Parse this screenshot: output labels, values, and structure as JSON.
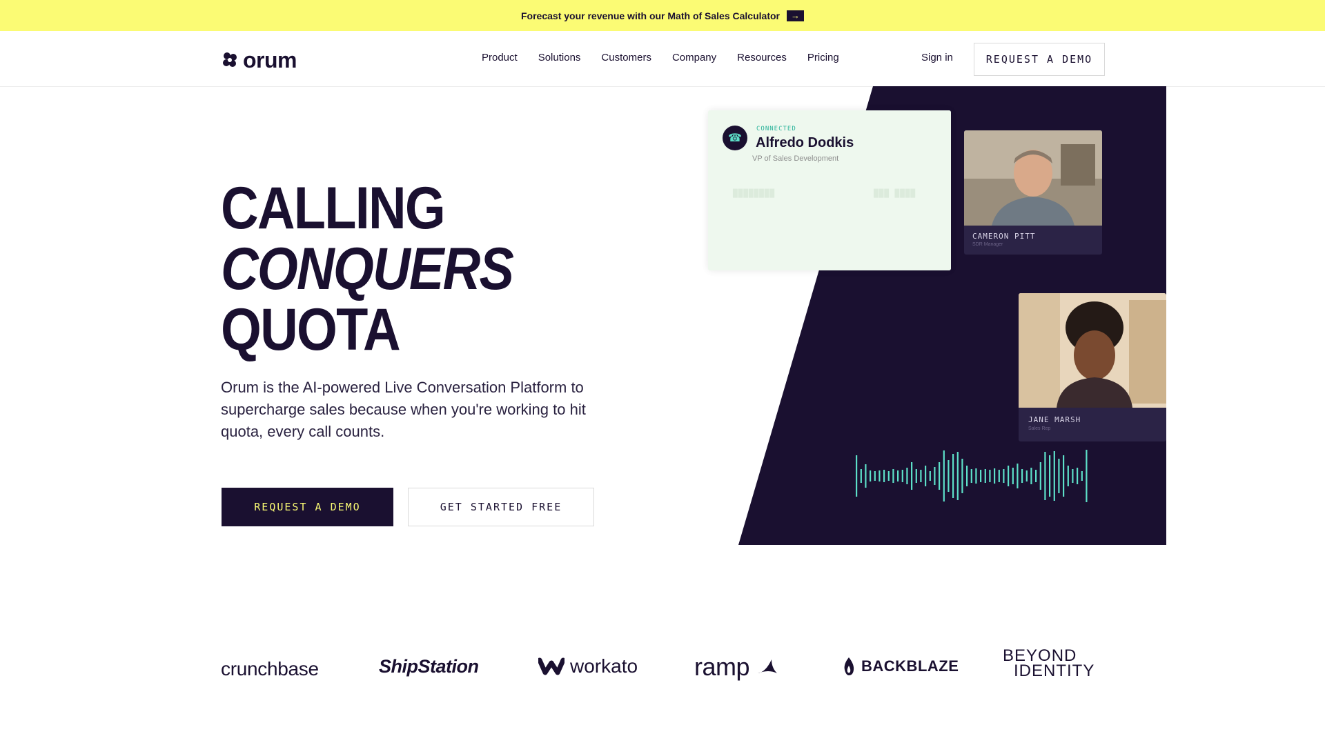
{
  "announcement": {
    "text": "Forecast your revenue with our Math of Sales Calculator",
    "arrow_icon": "arrow-right-icon"
  },
  "nav": {
    "brand": "orum",
    "links": [
      "Product",
      "Solutions",
      "Customers",
      "Company",
      "Resources",
      "Pricing"
    ],
    "sign_in": "Sign in",
    "demo_button": "REQUEST A DEMO"
  },
  "hero": {
    "headline_line1": "CALLING",
    "headline_line2": "CONQUERS",
    "headline_line3": "QUOTA",
    "subtext": "Orum is the AI-powered Live Conversation Platform to supercharge sales because when you're working to hit quota, every call counts.",
    "primary_button": "REQUEST A DEMO",
    "secondary_button": "GET STARTED FREE"
  },
  "call_visual": {
    "status": "CONNECTED",
    "caller_name": "Alfredo Dodkis",
    "caller_title": "VP of Sales Development",
    "participants": [
      {
        "name": "CAMERON PITT",
        "role": "SDR Manager"
      },
      {
        "name": "JANE MARSH",
        "role": "Sales Rep"
      }
    ]
  },
  "customer_logos": [
    "crunchbase",
    "ShipStation",
    "workato",
    "ramp",
    "BACKBLAZE",
    "BEYOND",
    "IDENTITY"
  ],
  "colors": {
    "announcement_bg": "#fbfb74",
    "brand_dark": "#1a1030",
    "accent_teal": "#5de0c9",
    "card_green": "#eef8ee"
  }
}
